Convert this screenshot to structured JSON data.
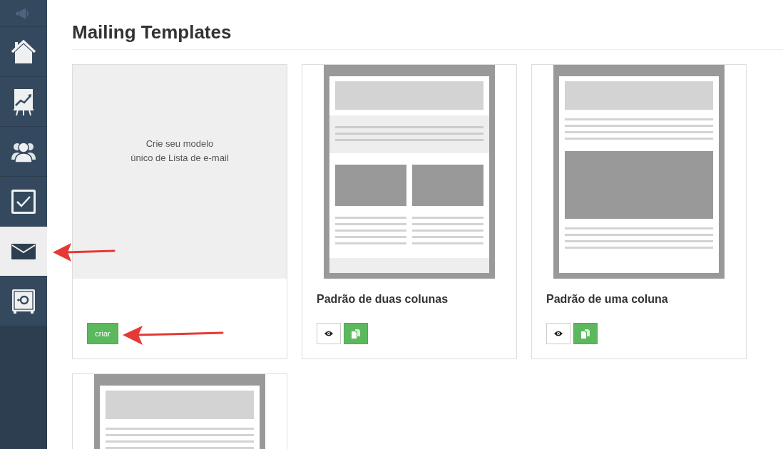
{
  "sidebar": {
    "items": [
      {
        "kind": "speaker",
        "selected": false
      },
      {
        "kind": "home",
        "selected": false
      },
      {
        "kind": "chart",
        "selected": false
      },
      {
        "kind": "people",
        "selected": false
      },
      {
        "kind": "tasks",
        "selected": false
      },
      {
        "kind": "mail",
        "selected": true
      },
      {
        "kind": "safe",
        "selected": false
      }
    ]
  },
  "title": "Mailing Templates",
  "templates": [
    {
      "kind": "create",
      "lines": [
        "Crie seu modelo",
        "único de Lista de e-mail"
      ],
      "button": "criar"
    },
    {
      "kind": "two-column",
      "name": "Padrão de duas colunas"
    },
    {
      "kind": "one-column",
      "name": "Padrão de uma coluna"
    },
    {
      "kind": "one-column"
    }
  ]
}
